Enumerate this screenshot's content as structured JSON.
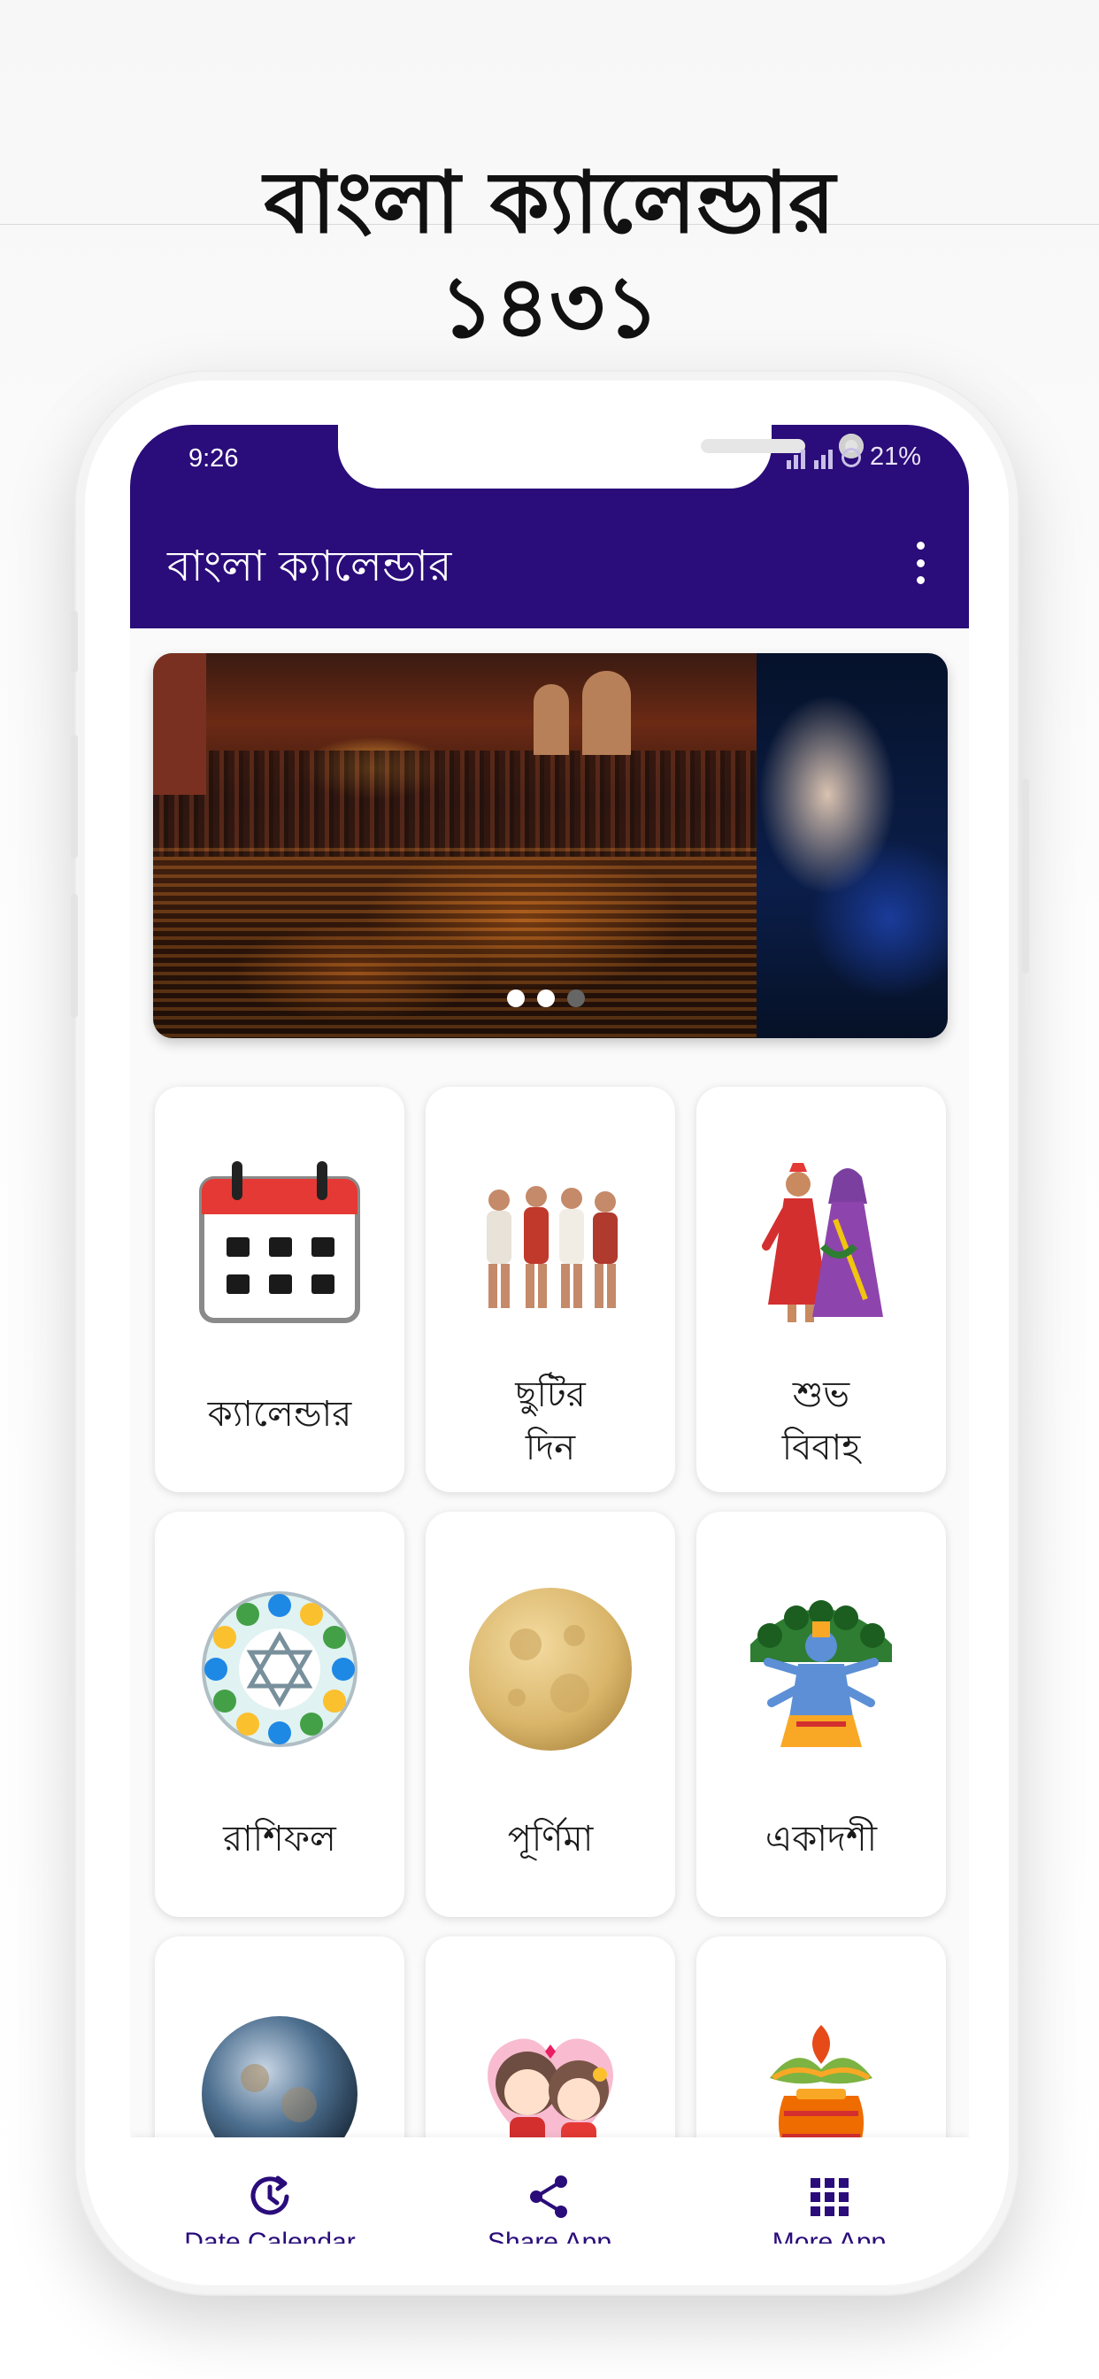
{
  "promo": {
    "title_line1": "বাংলা ক্যালেন্ডার",
    "title_line2": "১৪৩১"
  },
  "status_bar": {
    "time": "9:26",
    "battery": "21%"
  },
  "app_bar": {
    "title": "বাংলা ক্যালেন্ডার",
    "menu_icon": "more-vert-icon"
  },
  "colors": {
    "primary": "#2a0c7a",
    "accent_red": "#e53935"
  },
  "carousel": {
    "slides": [
      "ganga-aarti-image",
      "ganesha-image"
    ],
    "active_index": 1,
    "dot_count": 3
  },
  "grid": {
    "items": [
      {
        "label": "ক্যালেন্ডার",
        "icon": "calendar-icon"
      },
      {
        "label": "ছুটির\nদিন",
        "icon": "holiday-people-icon"
      },
      {
        "label": "শুভ\nবিবাহ",
        "icon": "wedding-couple-icon"
      },
      {
        "label": "রাশিফল",
        "icon": "zodiac-wheel-icon"
      },
      {
        "label": "পূর্ণিমা",
        "icon": "full-moon-icon"
      },
      {
        "label": "একাদশী",
        "icon": "vishnu-icon"
      },
      {
        "label": "",
        "icon": "new-moon-icon"
      },
      {
        "label": "",
        "icon": "love-couple-icon"
      },
      {
        "label": "",
        "icon": "kalash-icon"
      }
    ]
  },
  "bottom_nav": {
    "items": [
      {
        "label": "Date Calendar",
        "icon": "date-calendar-icon"
      },
      {
        "label": "Share App",
        "icon": "share-icon"
      },
      {
        "label": "More App",
        "icon": "apps-grid-icon"
      }
    ]
  }
}
